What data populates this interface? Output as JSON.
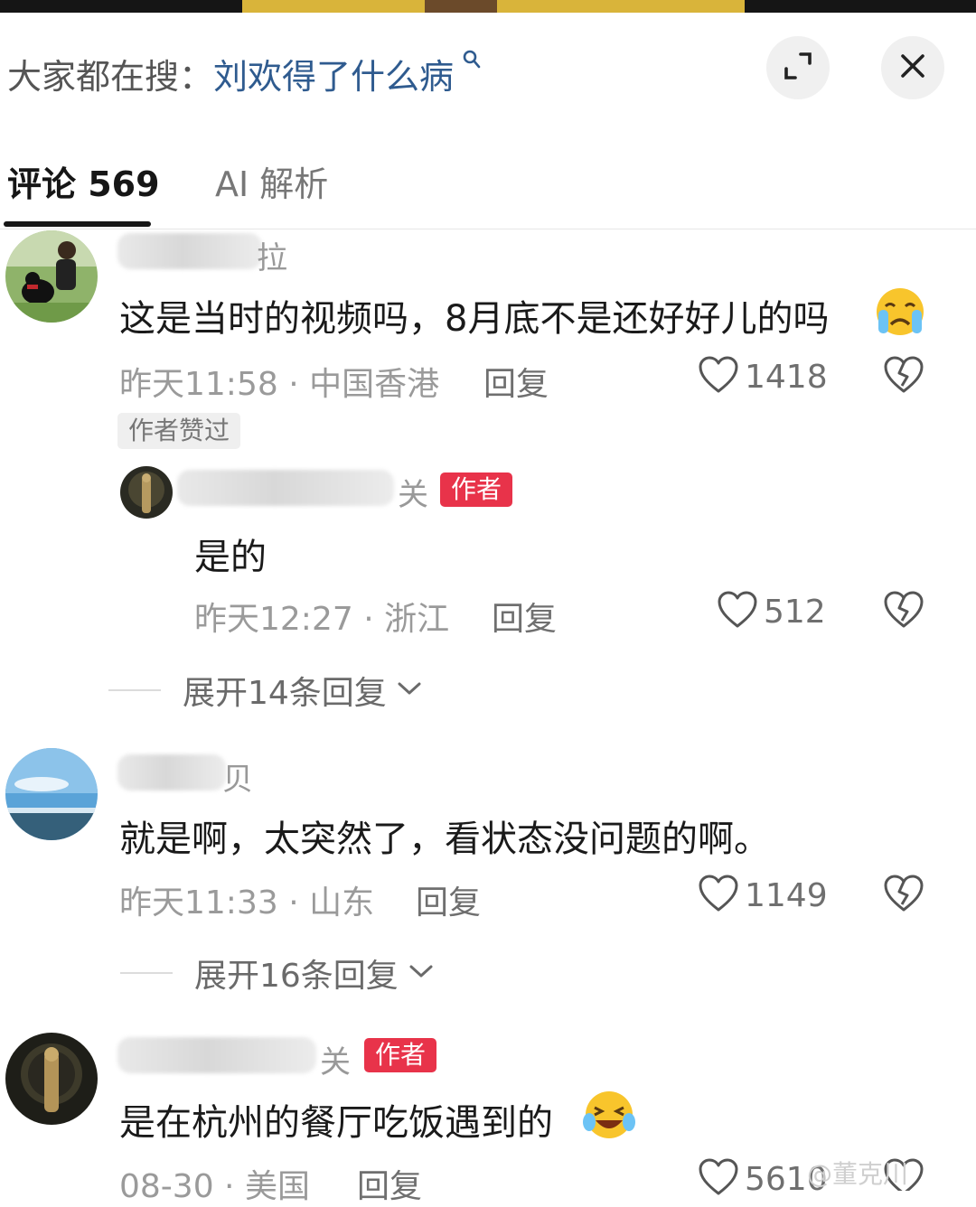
{
  "search": {
    "prefix": "大家都在搜：",
    "query": "刘欢得了什么病"
  },
  "tabs": {
    "comments": "评论 569",
    "ai": "AI 解析"
  },
  "comments": [
    {
      "name_tail": "拉",
      "text": "这是当时的视频吗，8月底不是还好好儿的吗",
      "time": "昨天11:58 · 中国香港",
      "reply": "回复",
      "likes": "1418",
      "liked_tag": "作者赞过",
      "sub_reply": {
        "name_tail": "关",
        "badge": "作者",
        "text": "是的",
        "time": "昨天12:27 · 浙江",
        "reply": "回复",
        "likes": "512"
      },
      "expand": "展开14条回复"
    },
    {
      "name_tail": "贝",
      "text": "就是啊，太突然了，看状态没问题的啊。",
      "time": "昨天11:33 · 山东",
      "reply": "回复",
      "likes": "1149",
      "expand": "展开16条回复"
    },
    {
      "name_tail": "关",
      "badge": "作者",
      "text": "是在杭州的餐厅吃饭遇到的",
      "time": "08-30 · 美国",
      "reply": "回复",
      "likes": "5610"
    }
  ],
  "watermark": "@董克川",
  "colors": {
    "author_badge": "#e8334a",
    "search_query": "#2f5b8f"
  }
}
